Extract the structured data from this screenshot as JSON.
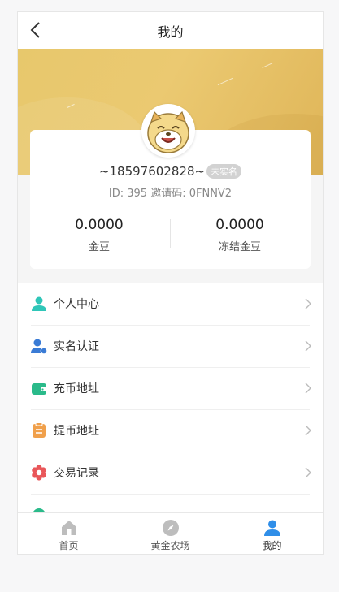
{
  "header": {
    "title": "我的"
  },
  "user": {
    "phone_display": "~18597602828~",
    "verify_badge": "未实名",
    "id_line": "ID: 395  邀请码: 0FNNV2"
  },
  "stats": [
    {
      "value": "0.0000",
      "label": "金豆"
    },
    {
      "value": "0.0000",
      "label": "冻结金豆"
    }
  ],
  "menu": [
    {
      "label": "个人中心",
      "icon": "user-icon",
      "color": "#2fc6b8"
    },
    {
      "label": "实名认证",
      "icon": "user-verify-icon",
      "color": "#3a7bd5"
    },
    {
      "label": "充币地址",
      "icon": "wallet-icon",
      "color": "#2aba8a"
    },
    {
      "label": "提币地址",
      "icon": "clipboard-icon",
      "color": "#f0a04b"
    },
    {
      "label": "交易记录",
      "icon": "flower-icon",
      "color": "#e9575a"
    }
  ],
  "tabs": [
    {
      "label": "首页",
      "icon": "home-icon",
      "active": false
    },
    {
      "label": "黄金农场",
      "icon": "compass-icon",
      "active": false
    },
    {
      "label": "我的",
      "icon": "profile-icon",
      "active": true
    }
  ],
  "colors": {
    "banner": "#e7c86c",
    "active_tab": "#2f8ee8",
    "inactive_tab": "#bdbdbd"
  }
}
